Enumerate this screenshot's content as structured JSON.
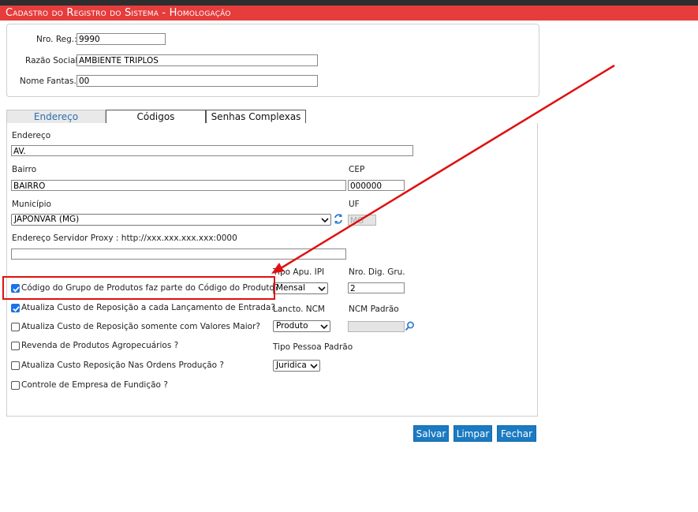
{
  "header": {
    "title": "Cadastro do Registro do Sistema  - Homologação"
  },
  "top_form": {
    "nro_reg": {
      "label": "Nro. Reg.:",
      "value": "9990"
    },
    "razao_social": {
      "label": "Razão Social:",
      "value": "AMBIENTE TRIPLOS"
    },
    "nome_fantasia": {
      "label": "Nome Fantas.:",
      "value": "00"
    }
  },
  "tabs": [
    {
      "label": "Endereço",
      "active": true
    },
    {
      "label": "Códigos",
      "active": false
    },
    {
      "label": "Senhas Complexas",
      "active": false
    }
  ],
  "endereco": {
    "endereco": {
      "label": "Endereço",
      "value": "AV."
    },
    "bairro": {
      "label": "Bairro",
      "value": "BAIRRO"
    },
    "cep": {
      "label": "CEP",
      "value": "000000"
    },
    "municipio": {
      "label": "Município",
      "value": "JAPONVAR (MG)"
    },
    "uf": {
      "label": "UF",
      "value": "MG"
    },
    "proxy": {
      "label": "Endereço Servidor Proxy : http://xxx.xxx.xxx.xxx:0000",
      "value": ""
    }
  },
  "options": {
    "tipo_apu_ipi": {
      "label": "Tipo Apu. IPI",
      "value": "Mensal"
    },
    "nro_dig_gru": {
      "label": "Nro. Dig. Gru.",
      "value": "2"
    },
    "lancto_ncm": {
      "label": "Lancto. NCM",
      "value": "Produto"
    },
    "ncm_padrao": {
      "label": "NCM Padrão",
      "value": ""
    },
    "tipo_pessoa_padrao": {
      "label": "Tipo Pessoa Padrão",
      "value": "Juridica"
    },
    "checkboxes": [
      {
        "label": "Código do Grupo de Produtos faz parte do Código do Produto?",
        "checked": true
      },
      {
        "label": "Atualiza Custo de Reposição a cada Lançamento de Entrada?",
        "checked": true
      },
      {
        "label": "Atualiza Custo de Reposição somente com Valores Maior?",
        "checked": false
      },
      {
        "label": "Revenda de Produtos Agropecuários ?",
        "checked": false
      },
      {
        "label": "Atualiza Custo Reposição Nas Ordens Produção ?",
        "checked": false
      },
      {
        "label": "Controle de Empresa de Fundição ?",
        "checked": false
      }
    ]
  },
  "buttons": {
    "save": "Salvar",
    "clear": "Limpar",
    "close": "Fechar"
  },
  "colors": {
    "title_bar": "#e63c3c",
    "button": "#1b7ac2",
    "checkbox_checked": "#1a73e8",
    "annotation": "#e01010"
  },
  "icons": [
    "refresh-icon",
    "search-icon",
    "chevron-down-icon",
    "check-icon",
    "annotation-arrow"
  ]
}
